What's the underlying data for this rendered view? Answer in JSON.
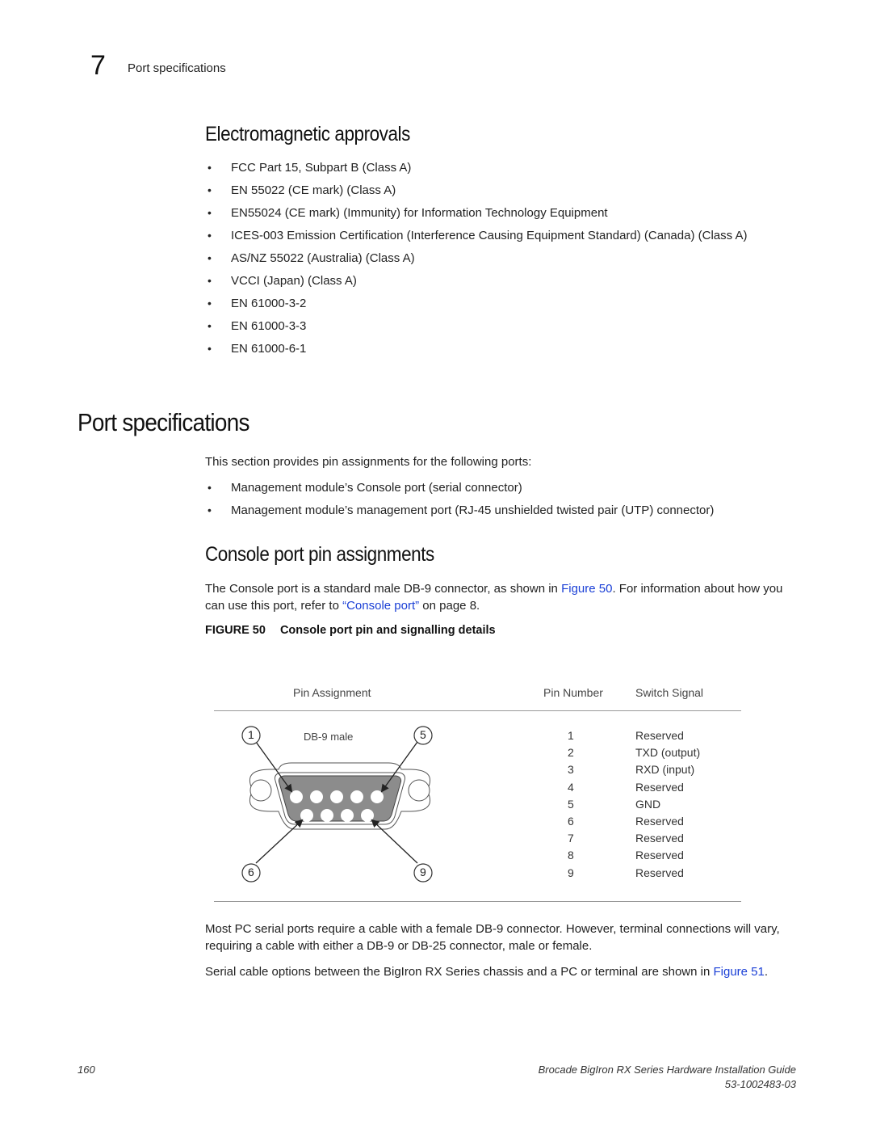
{
  "header": {
    "chapter_number": "7",
    "running_head": "Port specifications"
  },
  "electromagnetic": {
    "title": "Electromagnetic approvals",
    "items": [
      "FCC Part 15, Subpart B (Class A)",
      "EN 55022 (CE mark) (Class A)",
      "EN55024 (CE mark) (Immunity) for Information Technology Equipment",
      "ICES-003 Emission Certification (Interference Causing Equipment Standard) (Canada) (Class A)",
      "AS/NZ 55022 (Australia) (Class A)",
      "VCCI (Japan) (Class A)",
      "EN 61000-3-2",
      "EN 61000-3-3",
      "EN 61000-6-1"
    ]
  },
  "port_specs": {
    "title": "Port specifications",
    "intro": "This section provides pin assignments for the following ports:",
    "items": [
      "Management module’s Console port (serial connector)",
      "Management module’s management port (RJ-45 unshielded twisted pair (UTP) connector)"
    ]
  },
  "console": {
    "title": "Console port pin assignments",
    "para_part1": "The Console port is a standard male DB-9 connector, as shown in ",
    "para_link1": "Figure 50",
    "para_part2": ". For information about how you can use this port, refer to ",
    "para_link2": "“Console port”",
    "para_part3": " on page 8."
  },
  "figure": {
    "label": "FIGURE 50",
    "caption": "Console port pin and signalling details",
    "col_pin_assignment": "Pin Assignment",
    "col_pin_number": "Pin Number",
    "col_switch_signal": "Switch Signal",
    "connector_label": "DB-9 male",
    "callouts": [
      "1",
      "5",
      "6",
      "9"
    ],
    "pins": [
      {
        "number": "1",
        "signal": "Reserved"
      },
      {
        "number": "2",
        "signal": "TXD (output)"
      },
      {
        "number": "3",
        "signal": "RXD (input)"
      },
      {
        "number": "4",
        "signal": "Reserved"
      },
      {
        "number": "5",
        "signal": "GND"
      },
      {
        "number": "6",
        "signal": "Reserved"
      },
      {
        "number": "7",
        "signal": "Reserved"
      },
      {
        "number": "8",
        "signal": "Reserved"
      },
      {
        "number": "9",
        "signal": "Reserved"
      }
    ]
  },
  "after_figure": {
    "para1": "Most PC serial ports require a cable with a female DB-9 connector. However, terminal connections will vary, requiring a cable with either a DB-9 or DB-25 connector, male or female.",
    "para2_part1": "Serial cable options between the BigIron RX Series chassis and a PC or terminal are shown in ",
    "para2_link": "Figure 51",
    "para2_part2": "."
  },
  "footer": {
    "page_number": "160",
    "doc_title": "Brocade BigIron RX Series Hardware Installation Guide",
    "doc_number": "53-1002483-03"
  },
  "colors": {
    "link": "#1a3fd6",
    "connector_fill": "#8c8c8c"
  }
}
